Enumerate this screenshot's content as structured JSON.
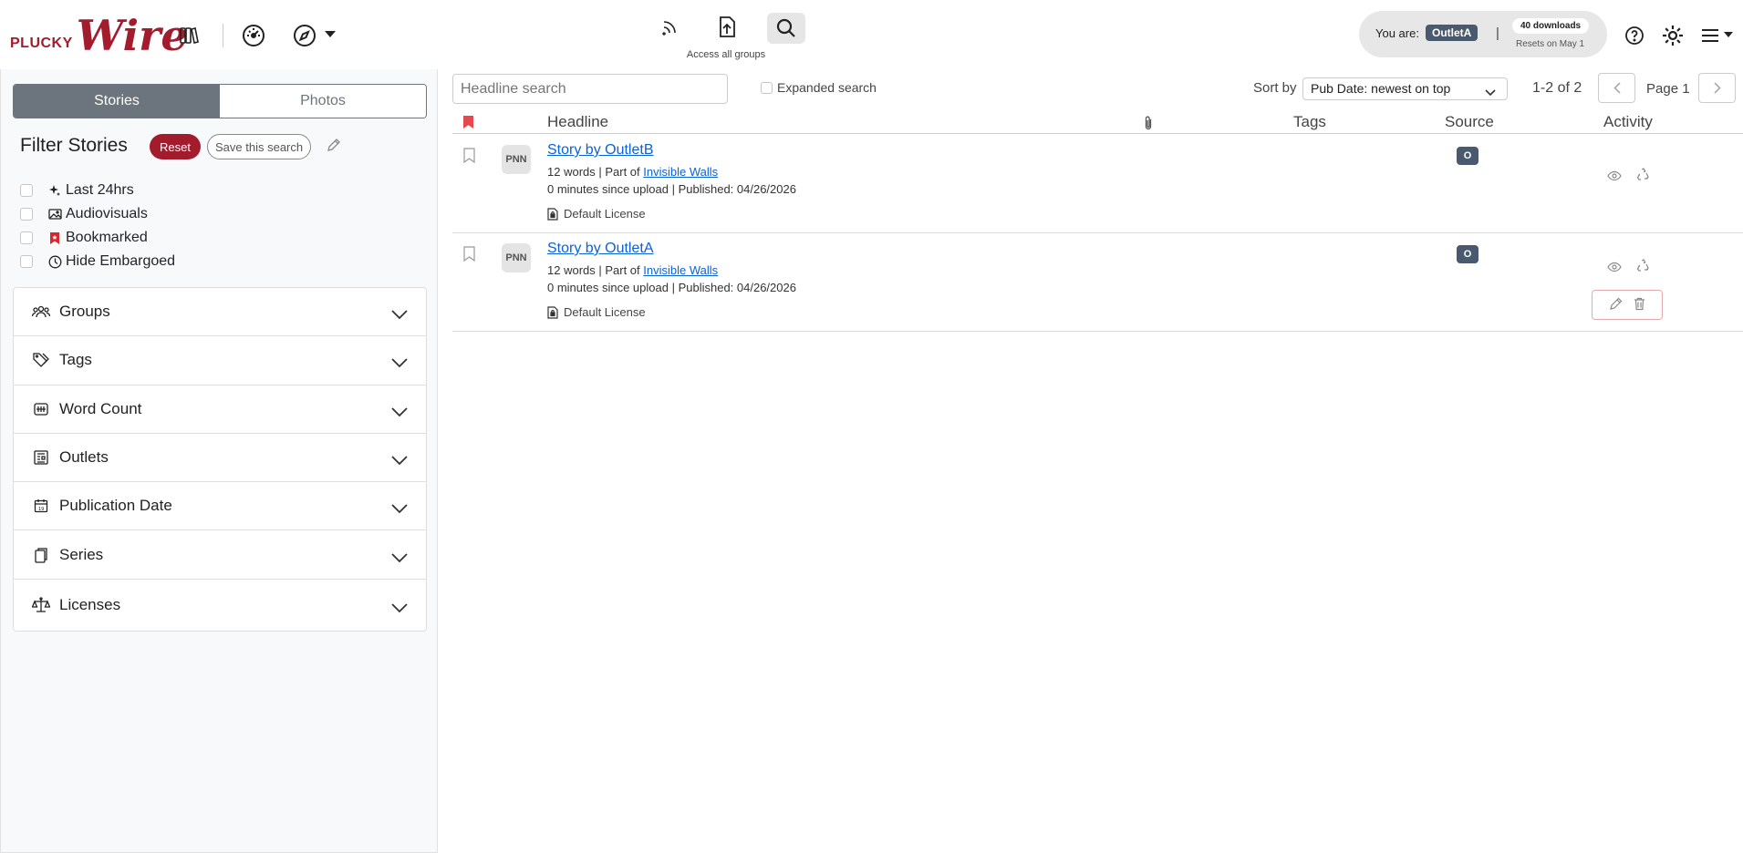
{
  "brand": {
    "plucky": "PLUCKY",
    "wire": "Wire"
  },
  "nav": {
    "center_label": "Access all groups",
    "icons": [
      "library-icon",
      "dashboard-icon",
      "compass-icon",
      "rss-icon",
      "upload-icon",
      "search-icon",
      "help-icon",
      "gear-icon",
      "menu-icon"
    ]
  },
  "user": {
    "you_are": "You are:",
    "outlet": "OutletA",
    "separator": "|",
    "downloads": "40 downloads",
    "resets": "Resets on May 1"
  },
  "sidebar": {
    "tabs": [
      "Stories",
      "Photos"
    ],
    "filter_title": "Filter Stories",
    "reset": "Reset",
    "save_search": "Save this search",
    "quick_filters": [
      "Last 24hrs",
      "Audiovisuals",
      "Bookmarked",
      "Hide Embargoed"
    ],
    "sections": [
      "Groups",
      "Tags",
      "Word Count",
      "Outlets",
      "Publication Date",
      "Series",
      "Licenses"
    ]
  },
  "main": {
    "search_placeholder": "Headline search",
    "expanded_search": "Expanded search",
    "sort_by": "Sort by",
    "sort_value": "Pub Date: newest on top",
    "count": "1-2 of 2",
    "page": "Page 1",
    "columns": {
      "headline": "Headline",
      "tags": "Tags",
      "source": "Source",
      "activity": "Activity"
    },
    "rows": [
      {
        "badge": "PNN",
        "headline": "Story by OutletB",
        "words": "12 words | Part of ",
        "series": "Invisible Walls",
        "since": "0 minutes since upload  | Published: 04/26/2026",
        "license": "Default License",
        "source": "O"
      },
      {
        "badge": "PNN",
        "headline": "Story by OutletA",
        "words": "12 words | Part of ",
        "series": "Invisible Walls",
        "since": "0 minutes since upload  | Published: 04/26/2026",
        "license": "Default License",
        "source": "O"
      }
    ]
  },
  "colors": {
    "brand": "#a31c2e",
    "badge": "#4a5a6e"
  }
}
